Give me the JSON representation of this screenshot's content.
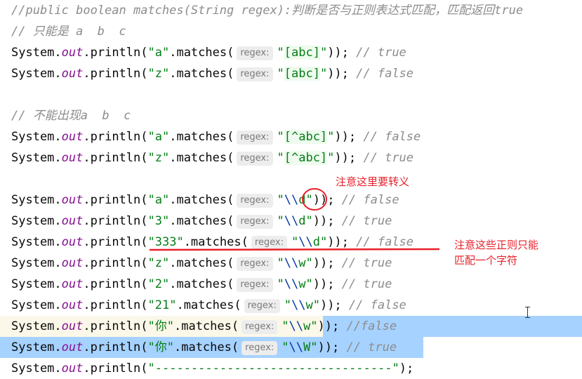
{
  "lines": [
    [
      [
        "cm",
        "//public boolean matches(String regex):判断是否与正则表达式匹配，匹配返回true"
      ]
    ],
    [
      [
        "cm",
        "// 只能是 a  b  c"
      ]
    ],
    [
      [
        "p",
        "System."
      ],
      [
        "out",
        "out"
      ],
      [
        "p",
        ".println("
      ],
      [
        "str",
        "\"a\""
      ],
      [
        "p",
        ".matches("
      ],
      [
        "hint",
        "regex:"
      ],
      [
        "str",
        "\""
      ],
      [
        "rxs",
        "[abc]"
      ],
      [
        "str",
        "\""
      ],
      [
        "p",
        "));"
      ],
      [
        "cm",
        " // true"
      ]
    ],
    [
      [
        "p",
        "System."
      ],
      [
        "out",
        "out"
      ],
      [
        "p",
        ".println("
      ],
      [
        "str",
        "\"z\""
      ],
      [
        "p",
        ".matches("
      ],
      [
        "hint",
        "regex:"
      ],
      [
        "str",
        "\""
      ],
      [
        "rxs",
        "[abc]"
      ],
      [
        "str",
        "\""
      ],
      [
        "p",
        "));"
      ],
      [
        "cm",
        " // false"
      ]
    ],
    [],
    [
      [
        "cm",
        "// 不能出现a  b  c"
      ]
    ],
    [
      [
        "p",
        "System."
      ],
      [
        "out",
        "out"
      ],
      [
        "p",
        ".println("
      ],
      [
        "str",
        "\"a\""
      ],
      [
        "p",
        ".matches("
      ],
      [
        "hint",
        "regex:"
      ],
      [
        "str",
        "\""
      ],
      [
        "rxs",
        "[^abc]"
      ],
      [
        "str",
        "\""
      ],
      [
        "p",
        "));"
      ],
      [
        "cm",
        " // false"
      ]
    ],
    [
      [
        "p",
        "System."
      ],
      [
        "out",
        "out"
      ],
      [
        "p",
        ".println("
      ],
      [
        "str",
        "\"z\""
      ],
      [
        "p",
        ".matches("
      ],
      [
        "hint",
        "regex:"
      ],
      [
        "str",
        "\""
      ],
      [
        "rxs",
        "[^abc]"
      ],
      [
        "str",
        "\""
      ],
      [
        "p",
        "));"
      ],
      [
        "cm",
        " // true"
      ]
    ],
    [],
    [
      [
        "p",
        "System."
      ],
      [
        "out",
        "out"
      ],
      [
        "p",
        ".println("
      ],
      [
        "str",
        "\"a\""
      ],
      [
        "p",
        ".matches("
      ],
      [
        "hint",
        "regex:"
      ],
      [
        "str",
        "\""
      ],
      [
        "esc",
        "\\\\"
      ],
      [
        "str",
        "d\""
      ],
      [
        "p",
        "));"
      ],
      [
        "cm",
        " // false"
      ]
    ],
    [
      [
        "p",
        "System."
      ],
      [
        "out",
        "out"
      ],
      [
        "p",
        ".println("
      ],
      [
        "str",
        "\"3\""
      ],
      [
        "p",
        ".matches("
      ],
      [
        "hint",
        "regex:"
      ],
      [
        "str",
        "\""
      ],
      [
        "esc",
        "\\\\"
      ],
      [
        "str",
        "d\""
      ],
      [
        "p",
        "));"
      ],
      [
        "cm",
        " // true"
      ]
    ],
    [
      [
        "p",
        "System."
      ],
      [
        "out",
        "out"
      ],
      [
        "p",
        ".println("
      ],
      [
        "str",
        "\"333\""
      ],
      [
        "p",
        ".matches("
      ],
      [
        "hint",
        "regex:"
      ],
      [
        "str",
        "\""
      ],
      [
        "esc",
        "\\\\"
      ],
      [
        "str",
        "d\""
      ],
      [
        "p",
        "));"
      ],
      [
        "cm",
        " // false"
      ]
    ],
    [
      [
        "p",
        "System."
      ],
      [
        "out",
        "out"
      ],
      [
        "p",
        ".println("
      ],
      [
        "str",
        "\"z\""
      ],
      [
        "p",
        ".matches("
      ],
      [
        "hint",
        "regex:"
      ],
      [
        "str",
        "\""
      ],
      [
        "esc",
        "\\\\"
      ],
      [
        "str",
        "w\""
      ],
      [
        "p",
        "));"
      ],
      [
        "cm",
        " // true"
      ]
    ],
    [
      [
        "p",
        "System."
      ],
      [
        "out",
        "out"
      ],
      [
        "p",
        ".println("
      ],
      [
        "str",
        "\"2\""
      ],
      [
        "p",
        ".matches("
      ],
      [
        "hint",
        "regex:"
      ],
      [
        "str",
        "\""
      ],
      [
        "esc",
        "\\\\"
      ],
      [
        "str",
        "w\""
      ],
      [
        "p",
        "));"
      ],
      [
        "cm",
        " // true"
      ]
    ],
    [
      [
        "p",
        "System."
      ],
      [
        "out",
        "out"
      ],
      [
        "p",
        ".println("
      ],
      [
        "str",
        "\"21\""
      ],
      [
        "p",
        ".matches("
      ],
      [
        "hint",
        "regex:"
      ],
      [
        "str",
        "\""
      ],
      [
        "esc",
        "\\\\"
      ],
      [
        "str",
        "w\""
      ],
      [
        "p",
        "));"
      ],
      [
        "cm",
        " // false"
      ]
    ],
    [
      [
        "p",
        "System."
      ],
      [
        "out",
        "out"
      ],
      [
        "p",
        ".println("
      ],
      [
        "str",
        "\"你\""
      ],
      [
        "p",
        ".matches("
      ],
      [
        "hint",
        "regex:"
      ],
      [
        "str",
        "\""
      ],
      [
        "esc",
        "\\\\"
      ],
      [
        "str",
        "w\""
      ],
      [
        "p",
        "));"
      ],
      [
        "cm",
        " //false"
      ]
    ],
    [
      [
        "p",
        "System."
      ],
      [
        "out",
        "out"
      ],
      [
        "p",
        ".println("
      ],
      [
        "str",
        "\"你\""
      ],
      [
        "p",
        ".matches("
      ],
      [
        "hint",
        "regex:"
      ],
      [
        "str",
        "\""
      ],
      [
        "esc",
        "\\\\"
      ],
      [
        "str",
        "W\""
      ],
      [
        "p",
        "));"
      ],
      [
        "cm",
        " // true"
      ]
    ],
    [
      [
        "p",
        "System."
      ],
      [
        "out",
        "out"
      ],
      [
        "p",
        ".println("
      ],
      [
        "str",
        "\"---------------------------------\""
      ],
      [
        "p",
        ");"
      ]
    ]
  ],
  "annotations": {
    "escape_note": "注意这里要转义",
    "single_char_note_1": "注意这些正则只能",
    "single_char_note_2": "匹配一个字符",
    "color": "#e8202a"
  }
}
